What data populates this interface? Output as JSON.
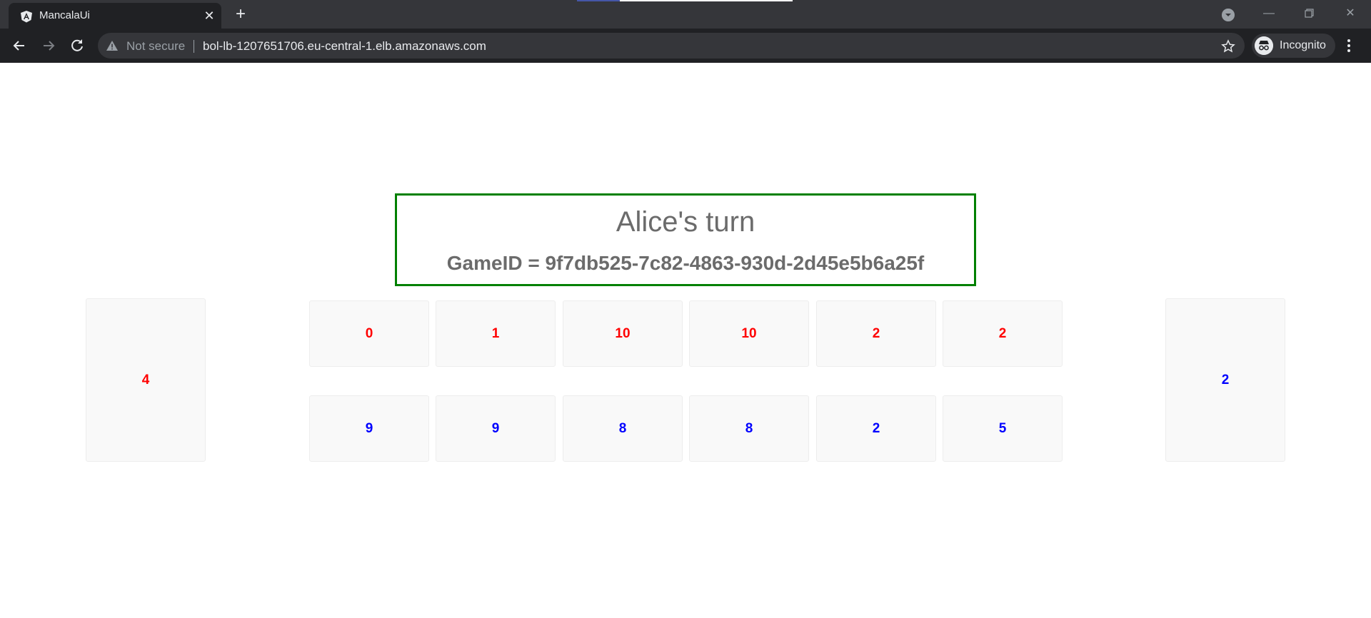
{
  "browser": {
    "tab_title": "MancalaUi",
    "security_label": "Not secure",
    "url": "bol-lb-1207651706.eu-central-1.elb.amazonaws.com",
    "incognito_label": "Incognito"
  },
  "game": {
    "turn_text": "Alice's turn",
    "game_id_text": "GameID = 9f7db525-7c82-4863-930d-2d45e5b6a25f",
    "status_border_color": "#008000",
    "player_red": {
      "color": "#ff0000",
      "store": "4",
      "pits": [
        "0",
        "1",
        "10",
        "10",
        "2",
        "2"
      ]
    },
    "player_blue": {
      "color": "#0000ff",
      "store": "2",
      "pits": [
        "9",
        "9",
        "8",
        "8",
        "2",
        "5"
      ]
    }
  }
}
